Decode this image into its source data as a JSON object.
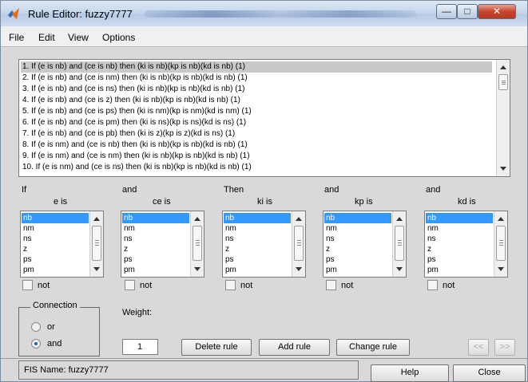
{
  "window": {
    "title": "Rule Editor: fuzzy7777"
  },
  "menu": [
    "File",
    "Edit",
    "View",
    "Options"
  ],
  "rules": [
    "1. If (e is nb) and (ce is nb) then (ki is nb)(kp is nb)(kd is nb) (1)",
    "2. If (e is nb) and (ce is nm) then (ki is nb)(kp is nb)(kd is nb) (1)",
    "3. If (e is nb) and (ce is ns) then (ki is nb)(kp is nb)(kd is nb) (1)",
    "4. If (e is nb) and (ce is z) then (ki is nb)(kp is nb)(kd is nb) (1)",
    "5. If (e is nb) and (ce is ps) then (ki is nm)(kp is nm)(kd is nm) (1)",
    "6. If (e is nb) and (ce is pm) then (ki is ns)(kp is ns)(kd is ns) (1)",
    "7. If (e is nb) and (ce is pb) then (ki is z)(kp is z)(kd is ns) (1)",
    "8. If (e is nm) and (ce is nb) then (ki is nb)(kp is nb)(kd is nb) (1)",
    "9. If (e is nm) and (ce is nm) then (ki is nb)(kp is nb)(kd is nb) (1)",
    "10. If (e is nm) and (ce is ns) then (ki is nb)(kp is nb)(kd is nb) (1)"
  ],
  "columns": [
    {
      "head1": "If",
      "head2": "e is"
    },
    {
      "head1": "and",
      "head2": "ce is"
    },
    {
      "head1": "Then",
      "head2": "ki is"
    },
    {
      "head1": "and",
      "head2": "kp is"
    },
    {
      "head1": "and",
      "head2": "kd is"
    }
  ],
  "options": [
    "nb",
    "nm",
    "ns",
    "z",
    "ps",
    "pm"
  ],
  "not_label": "not",
  "connection": {
    "title": "Connection",
    "or_label": "or",
    "and_label": "and",
    "selected": "and"
  },
  "weight": {
    "label": "Weight:",
    "value": "1"
  },
  "buttons": {
    "delete_rule": "Delete rule",
    "add_rule": "Add rule",
    "change_rule": "Change rule",
    "prev": "<<",
    "next": ">>",
    "help": "Help",
    "close": "Close"
  },
  "status": "FIS Name: fuzzy7777",
  "icons": {
    "title": "matlab-logo-icon"
  },
  "colors": {
    "selection": "#3399ff",
    "window_bg": "#d9d9d9"
  }
}
